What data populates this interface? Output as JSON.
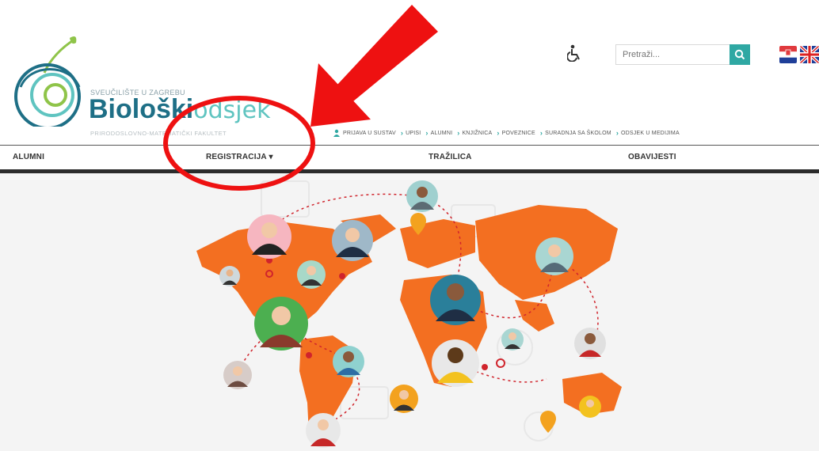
{
  "header": {
    "university": "SVEUČILIŠTE U ZAGREBU",
    "title_bold": "Biološki",
    "title_light": "odsjek",
    "subtitle": "PRIRODOSLOVNO-MATEMATIČKI FAKULTET"
  },
  "search": {
    "placeholder": "Pretraži..."
  },
  "quick_links": [
    {
      "label": "PRIJAVA U SUSTAV",
      "icon": "user-icon"
    },
    {
      "label": "UPISI"
    },
    {
      "label": "ALUMNI"
    },
    {
      "label": "KNJIŽNICA"
    },
    {
      "label": "POVEZNICE"
    },
    {
      "label": "SURADNJA SA ŠKOLOM"
    },
    {
      "label": "ODSJEK U MEDIJIMA"
    }
  ],
  "nav": {
    "alumni": "ALUMNI",
    "registracija": "REGISTRACIJA ▾",
    "trazilica": "TRAŽILICA",
    "obavijesti": "OBAVIJESTI"
  },
  "colors": {
    "accent": "#2fa8a3",
    "brand_dark": "#1e6f86",
    "map_orange": "#f36f21",
    "annotation_red": "#ee1111"
  },
  "icons": {
    "accessibility": "wheelchair-icon",
    "search": "search-icon"
  }
}
